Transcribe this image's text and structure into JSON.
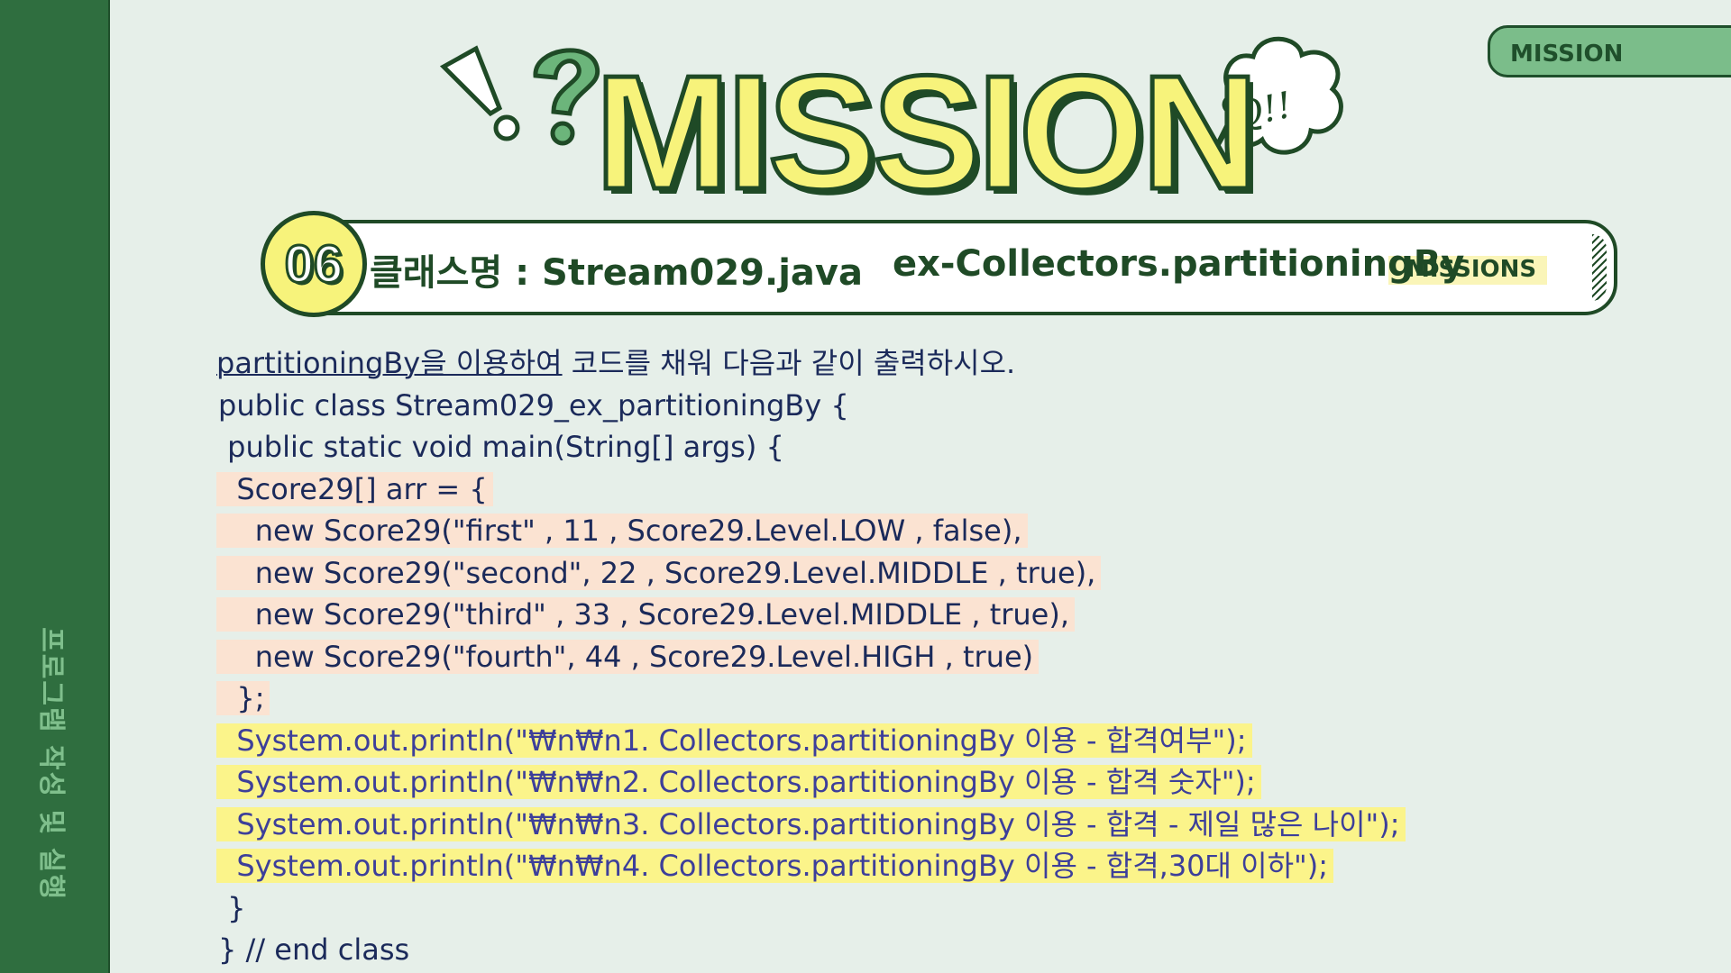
{
  "sidebar": {
    "label": "프로그램 작성 및 실행"
  },
  "corner_tab": {
    "label": "MISSION"
  },
  "header": {
    "title": "MISSION",
    "bubble_text": "Q!!"
  },
  "subtitle": {
    "number": "06",
    "class_name": "클래스명 : Stream029.java",
    "topic": "ex-Collectors.partitioningBy",
    "tag": "MISSIONS"
  },
  "instruction": {
    "underlined": "partitioningBy을 이용하여",
    "rest": " 코드를 채워 다음과 같이 출력하시오."
  },
  "code_lines": [
    {
      "text": "public class Stream029_ex_partitioningBy {",
      "style": "plain"
    },
    {
      "text": " public static void main(String[] args) {",
      "style": "plain"
    },
    {
      "text": "  Score29[] arr = {",
      "style": "peach"
    },
    {
      "text": "    new Score29(\"first\" , 11 , Score29.Level.LOW , false),",
      "style": "peach"
    },
    {
      "text": "    new Score29(\"second\", 22 , Score29.Level.MIDDLE , true),",
      "style": "peach"
    },
    {
      "text": "    new Score29(\"third\" , 33 , Score29.Level.MIDDLE , true),",
      "style": "peach"
    },
    {
      "text": "    new Score29(\"fourth\", 44 , Score29.Level.HIGH , true)",
      "style": "peach"
    },
    {
      "text": "  };",
      "style": "peach"
    },
    {
      "text": "  System.out.println(\"₩n₩n1. Collectors.partitioningBy 이용 - 합격여부\");",
      "style": "yellow"
    },
    {
      "text": "  System.out.println(\"₩n₩n2. Collectors.partitioningBy 이용 - 합격 숫자\");",
      "style": "yellow"
    },
    {
      "text": "  System.out.println(\"₩n₩n3. Collectors.partitioningBy 이용 - 합격 - 제일 많은 나이\");",
      "style": "yellow"
    },
    {
      "text": "  System.out.println(\"₩n₩n4. Collectors.partitioningBy 이용 - 합격,30대 이하\");",
      "style": "yellow"
    },
    {
      "text": " }",
      "style": "plain"
    },
    {
      "text": "} // end class",
      "style": "plain"
    }
  ],
  "colors": {
    "sidebar": "#2f6e3f",
    "background": "#e6efe9",
    "title_fill": "#f7f37b",
    "dark_green": "#1f4a26"
  }
}
